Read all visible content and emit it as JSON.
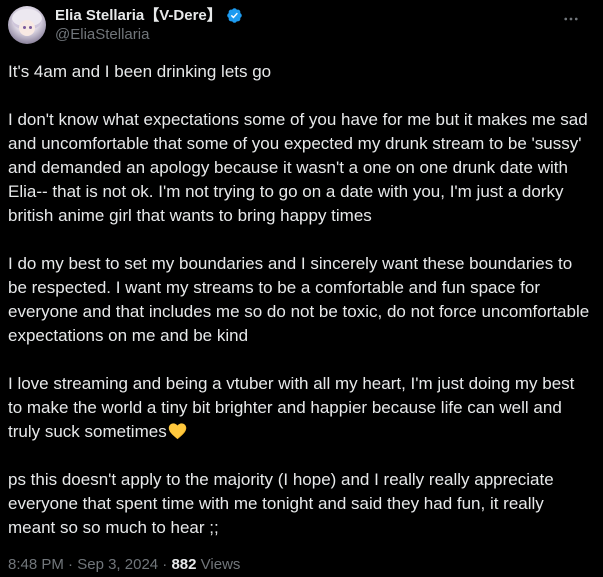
{
  "author": {
    "display_name": "Elia Stellaria【V-Dere】",
    "handle": "@EliaStellaria",
    "verified_badge_color": "#1d9bf0"
  },
  "tweet": {
    "paragraphs": [
      "It's 4am and I been drinking lets go",
      "I don't know what expectations some of you have for me but it makes me sad and uncomfortable that some of you expected my drunk stream to be 'sussy' and demanded an apology because it wasn't a one on one drunk date with Elia-- that is not ok. I'm not trying to go on a date with you, I'm just a dorky british anime girl that wants to bring happy times",
      "I do my best to set my boundaries and I sincerely want these boundaries to be respected. I want my streams to be a comfortable and fun space for everyone and that includes me so do not be toxic, do not force uncomfortable expectations on me and be kind",
      "I love streaming and being a vtuber with all my heart,  I'm just doing my best to make the world a tiny bit brighter and happier because life can well and truly suck sometimes",
      "ps this doesn't apply to the majority (I hope) and I really really appreciate everyone that spent time with me tonight and said they had fun, it really meant so so much to hear ;;"
    ],
    "emoji_after_paragraph_4": "yellow-heart-icon",
    "emoji_color": "#ffc83d"
  },
  "meta": {
    "time": "8:48 PM",
    "separator1": " · ",
    "date": "Sep 3, 2024",
    "separator2": " · ",
    "views_count": "882",
    "views_label": " Views"
  },
  "colors": {
    "background": "#000000",
    "text": "#e7e9ea",
    "secondary_text": "#71767b"
  }
}
